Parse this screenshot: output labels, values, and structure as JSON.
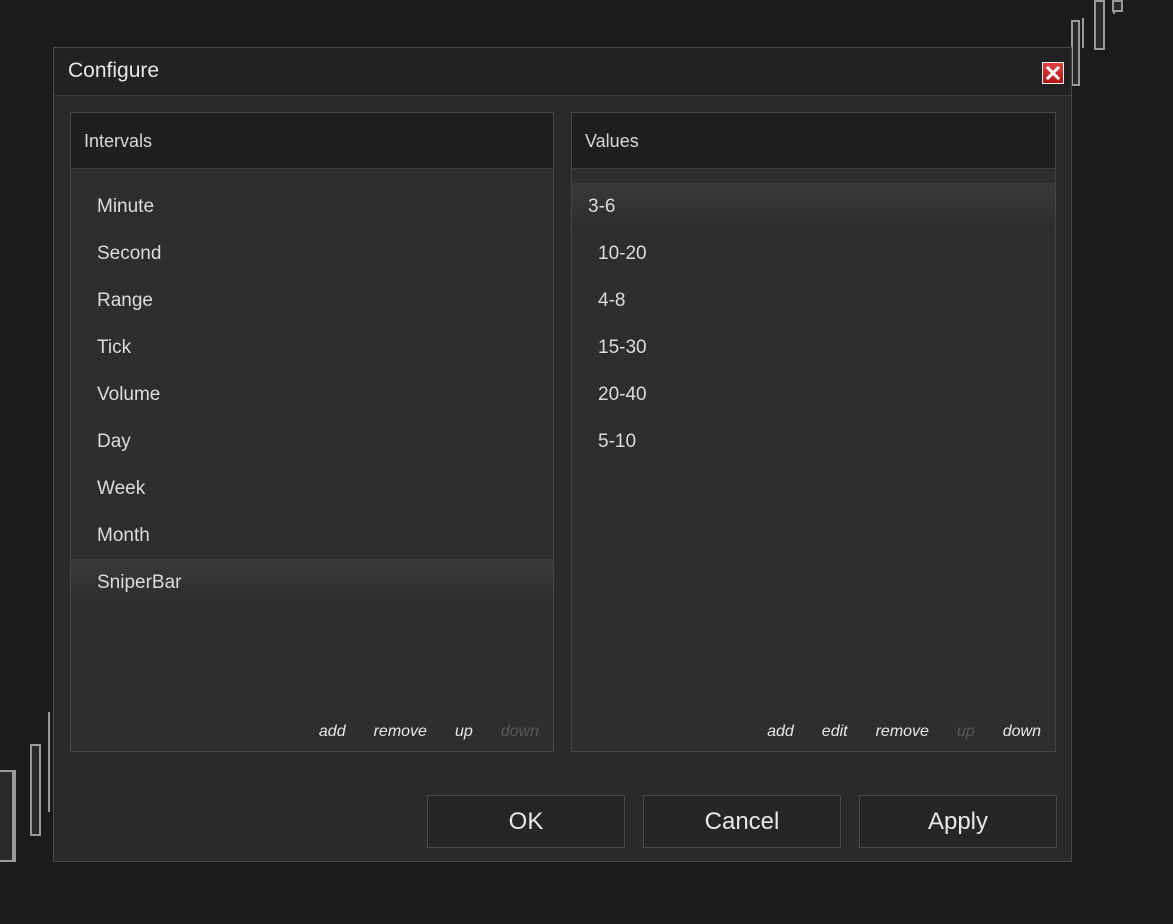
{
  "dialog": {
    "title": "Configure",
    "close_icon": "close-icon"
  },
  "intervals": {
    "header": "Intervals",
    "items": [
      "Minute",
      "Second",
      "Range",
      "Tick",
      "Volume",
      "Day",
      "Week",
      "Month",
      "SniperBar"
    ],
    "selected": "SniperBar",
    "actions": {
      "add": "add",
      "remove": "remove",
      "up": "up",
      "down": "down"
    },
    "disabled_actions": [
      "down"
    ]
  },
  "values": {
    "header": "Values",
    "items": [
      "3-6",
      "10-20",
      "4-8",
      "15-30",
      "20-40",
      "5-10"
    ],
    "selected": "3-6",
    "actions": {
      "add": "add",
      "edit": "edit",
      "remove": "remove",
      "up": "up",
      "down": "down"
    },
    "disabled_actions": [
      "up"
    ]
  },
  "buttons": {
    "ok": "OK",
    "cancel": "Cancel",
    "apply": "Apply"
  },
  "colors": {
    "background": "#1c1c1c",
    "dialog": "#2a2a2c",
    "header": "#1f1f20",
    "close_red": "#c82020",
    "disabled_text": "#5a5a5a"
  }
}
